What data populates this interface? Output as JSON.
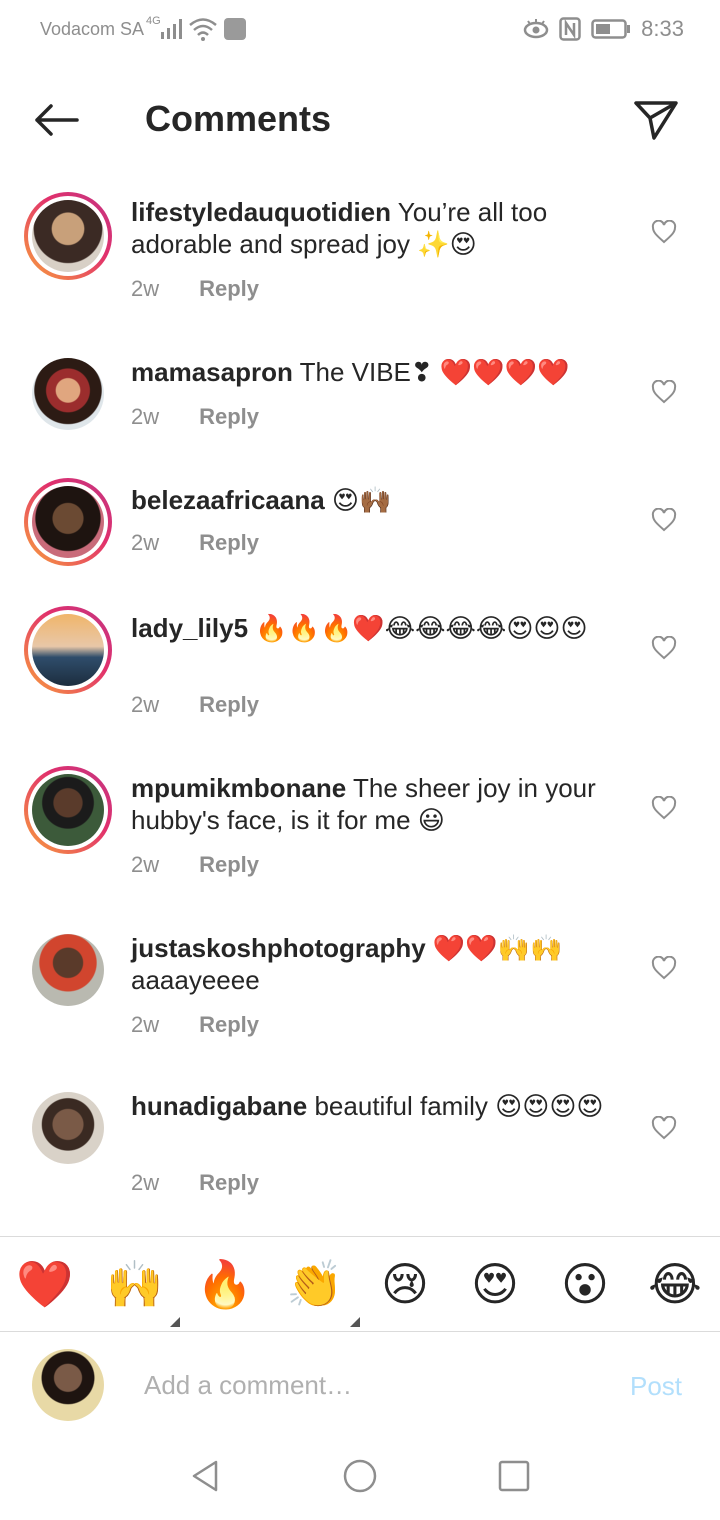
{
  "status_bar": {
    "carrier": "Vodacom SA",
    "network": "4G",
    "time": "8:33"
  },
  "header": {
    "title": "Comments"
  },
  "comments": [
    {
      "username": "lifestyledauquotidien",
      "text": " You’re all too adorable and spread joy ✨😍",
      "age": "2w",
      "reply_label": "Reply",
      "avatar_ring": true,
      "avatar_colors": [
        "#c8a07a",
        "#3b2a24"
      ]
    },
    {
      "username": "mamasapron",
      "text": " The VIBE❣ ❤️❤️❤️❤️",
      "age": "2w",
      "reply_label": "Reply",
      "avatar_ring": false,
      "avatar_colors": [
        "#9b2d2d",
        "#2c1b14"
      ]
    },
    {
      "username": "belezaafricaana",
      "text": " 😍🙌🏾",
      "age": "2w",
      "reply_label": "Reply",
      "avatar_ring": true,
      "avatar_colors": [
        "#6b4a33",
        "#1e1410"
      ]
    },
    {
      "username": "lady_lily5",
      "text": " 🔥🔥🔥❤️😂😂😂😂😍😍😍",
      "age": "2w",
      "reply_label": "Reply",
      "avatar_ring": true,
      "avatar_colors": [
        "#f0b56a",
        "#2f4d6b"
      ]
    },
    {
      "username": "mpumikmbonane",
      "text": " The sheer joy in your hubby's face, is it for me 😃",
      "age": "2w",
      "reply_label": "Reply",
      "avatar_ring": true,
      "avatar_colors": [
        "#3c5a3a",
        "#1b1b1b"
      ]
    },
    {
      "username": "justaskoshphotography",
      "text": " ❤️❤️🙌🙌 aaaayeeee",
      "age": "2w",
      "reply_label": "Reply",
      "avatar_ring": false,
      "avatar_colors": [
        "#d1452e",
        "#5a3a2a"
      ]
    },
    {
      "username": "hunadigabane",
      "text": " beautiful family 😍😍😍😍",
      "age": "2w",
      "reply_label": "Reply",
      "avatar_ring": false,
      "avatar_colors": [
        "#7a5a47",
        "#d9d2c8"
      ]
    }
  ],
  "emoji_bar": [
    "❤️",
    "🙌",
    "🔥",
    "👏",
    "😢",
    "😍",
    "😮",
    "😂"
  ],
  "compose": {
    "placeholder": "Add a comment…",
    "post_label": "Post"
  }
}
